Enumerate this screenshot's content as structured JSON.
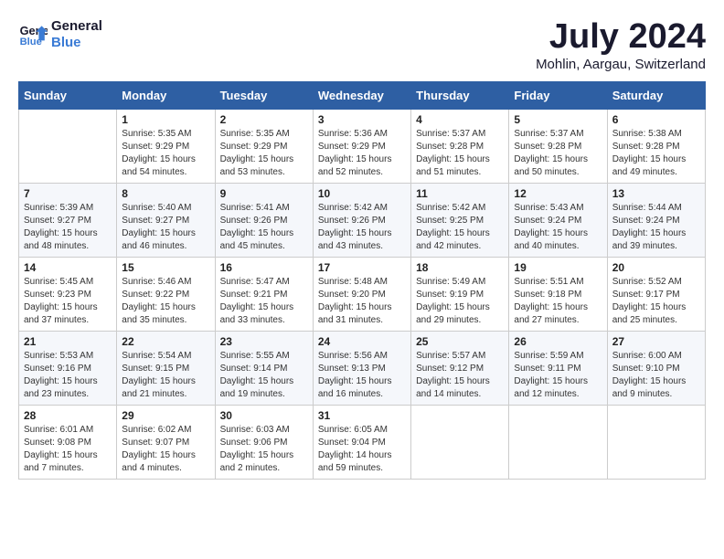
{
  "header": {
    "logo_line1": "General",
    "logo_line2": "Blue",
    "month_title": "July 2024",
    "location": "Mohlin, Aargau, Switzerland"
  },
  "weekdays": [
    "Sunday",
    "Monday",
    "Tuesday",
    "Wednesday",
    "Thursday",
    "Friday",
    "Saturday"
  ],
  "weeks": [
    [
      {
        "day": "",
        "sunrise": "",
        "sunset": "",
        "daylight": ""
      },
      {
        "day": "1",
        "sunrise": "Sunrise: 5:35 AM",
        "sunset": "Sunset: 9:29 PM",
        "daylight": "Daylight: 15 hours and 54 minutes."
      },
      {
        "day": "2",
        "sunrise": "Sunrise: 5:35 AM",
        "sunset": "Sunset: 9:29 PM",
        "daylight": "Daylight: 15 hours and 53 minutes."
      },
      {
        "day": "3",
        "sunrise": "Sunrise: 5:36 AM",
        "sunset": "Sunset: 9:29 PM",
        "daylight": "Daylight: 15 hours and 52 minutes."
      },
      {
        "day": "4",
        "sunrise": "Sunrise: 5:37 AM",
        "sunset": "Sunset: 9:28 PM",
        "daylight": "Daylight: 15 hours and 51 minutes."
      },
      {
        "day": "5",
        "sunrise": "Sunrise: 5:37 AM",
        "sunset": "Sunset: 9:28 PM",
        "daylight": "Daylight: 15 hours and 50 minutes."
      },
      {
        "day": "6",
        "sunrise": "Sunrise: 5:38 AM",
        "sunset": "Sunset: 9:28 PM",
        "daylight": "Daylight: 15 hours and 49 minutes."
      }
    ],
    [
      {
        "day": "7",
        "sunrise": "Sunrise: 5:39 AM",
        "sunset": "Sunset: 9:27 PM",
        "daylight": "Daylight: 15 hours and 48 minutes."
      },
      {
        "day": "8",
        "sunrise": "Sunrise: 5:40 AM",
        "sunset": "Sunset: 9:27 PM",
        "daylight": "Daylight: 15 hours and 46 minutes."
      },
      {
        "day": "9",
        "sunrise": "Sunrise: 5:41 AM",
        "sunset": "Sunset: 9:26 PM",
        "daylight": "Daylight: 15 hours and 45 minutes."
      },
      {
        "day": "10",
        "sunrise": "Sunrise: 5:42 AM",
        "sunset": "Sunset: 9:26 PM",
        "daylight": "Daylight: 15 hours and 43 minutes."
      },
      {
        "day": "11",
        "sunrise": "Sunrise: 5:42 AM",
        "sunset": "Sunset: 9:25 PM",
        "daylight": "Daylight: 15 hours and 42 minutes."
      },
      {
        "day": "12",
        "sunrise": "Sunrise: 5:43 AM",
        "sunset": "Sunset: 9:24 PM",
        "daylight": "Daylight: 15 hours and 40 minutes."
      },
      {
        "day": "13",
        "sunrise": "Sunrise: 5:44 AM",
        "sunset": "Sunset: 9:24 PM",
        "daylight": "Daylight: 15 hours and 39 minutes."
      }
    ],
    [
      {
        "day": "14",
        "sunrise": "Sunrise: 5:45 AM",
        "sunset": "Sunset: 9:23 PM",
        "daylight": "Daylight: 15 hours and 37 minutes."
      },
      {
        "day": "15",
        "sunrise": "Sunrise: 5:46 AM",
        "sunset": "Sunset: 9:22 PM",
        "daylight": "Daylight: 15 hours and 35 minutes."
      },
      {
        "day": "16",
        "sunrise": "Sunrise: 5:47 AM",
        "sunset": "Sunset: 9:21 PM",
        "daylight": "Daylight: 15 hours and 33 minutes."
      },
      {
        "day": "17",
        "sunrise": "Sunrise: 5:48 AM",
        "sunset": "Sunset: 9:20 PM",
        "daylight": "Daylight: 15 hours and 31 minutes."
      },
      {
        "day": "18",
        "sunrise": "Sunrise: 5:49 AM",
        "sunset": "Sunset: 9:19 PM",
        "daylight": "Daylight: 15 hours and 29 minutes."
      },
      {
        "day": "19",
        "sunrise": "Sunrise: 5:51 AM",
        "sunset": "Sunset: 9:18 PM",
        "daylight": "Daylight: 15 hours and 27 minutes."
      },
      {
        "day": "20",
        "sunrise": "Sunrise: 5:52 AM",
        "sunset": "Sunset: 9:17 PM",
        "daylight": "Daylight: 15 hours and 25 minutes."
      }
    ],
    [
      {
        "day": "21",
        "sunrise": "Sunrise: 5:53 AM",
        "sunset": "Sunset: 9:16 PM",
        "daylight": "Daylight: 15 hours and 23 minutes."
      },
      {
        "day": "22",
        "sunrise": "Sunrise: 5:54 AM",
        "sunset": "Sunset: 9:15 PM",
        "daylight": "Daylight: 15 hours and 21 minutes."
      },
      {
        "day": "23",
        "sunrise": "Sunrise: 5:55 AM",
        "sunset": "Sunset: 9:14 PM",
        "daylight": "Daylight: 15 hours and 19 minutes."
      },
      {
        "day": "24",
        "sunrise": "Sunrise: 5:56 AM",
        "sunset": "Sunset: 9:13 PM",
        "daylight": "Daylight: 15 hours and 16 minutes."
      },
      {
        "day": "25",
        "sunrise": "Sunrise: 5:57 AM",
        "sunset": "Sunset: 9:12 PM",
        "daylight": "Daylight: 15 hours and 14 minutes."
      },
      {
        "day": "26",
        "sunrise": "Sunrise: 5:59 AM",
        "sunset": "Sunset: 9:11 PM",
        "daylight": "Daylight: 15 hours and 12 minutes."
      },
      {
        "day": "27",
        "sunrise": "Sunrise: 6:00 AM",
        "sunset": "Sunset: 9:10 PM",
        "daylight": "Daylight: 15 hours and 9 minutes."
      }
    ],
    [
      {
        "day": "28",
        "sunrise": "Sunrise: 6:01 AM",
        "sunset": "Sunset: 9:08 PM",
        "daylight": "Daylight: 15 hours and 7 minutes."
      },
      {
        "day": "29",
        "sunrise": "Sunrise: 6:02 AM",
        "sunset": "Sunset: 9:07 PM",
        "daylight": "Daylight: 15 hours and 4 minutes."
      },
      {
        "day": "30",
        "sunrise": "Sunrise: 6:03 AM",
        "sunset": "Sunset: 9:06 PM",
        "daylight": "Daylight: 15 hours and 2 minutes."
      },
      {
        "day": "31",
        "sunrise": "Sunrise: 6:05 AM",
        "sunset": "Sunset: 9:04 PM",
        "daylight": "Daylight: 14 hours and 59 minutes."
      },
      {
        "day": "",
        "sunrise": "",
        "sunset": "",
        "daylight": ""
      },
      {
        "day": "",
        "sunrise": "",
        "sunset": "",
        "daylight": ""
      },
      {
        "day": "",
        "sunrise": "",
        "sunset": "",
        "daylight": ""
      }
    ]
  ]
}
